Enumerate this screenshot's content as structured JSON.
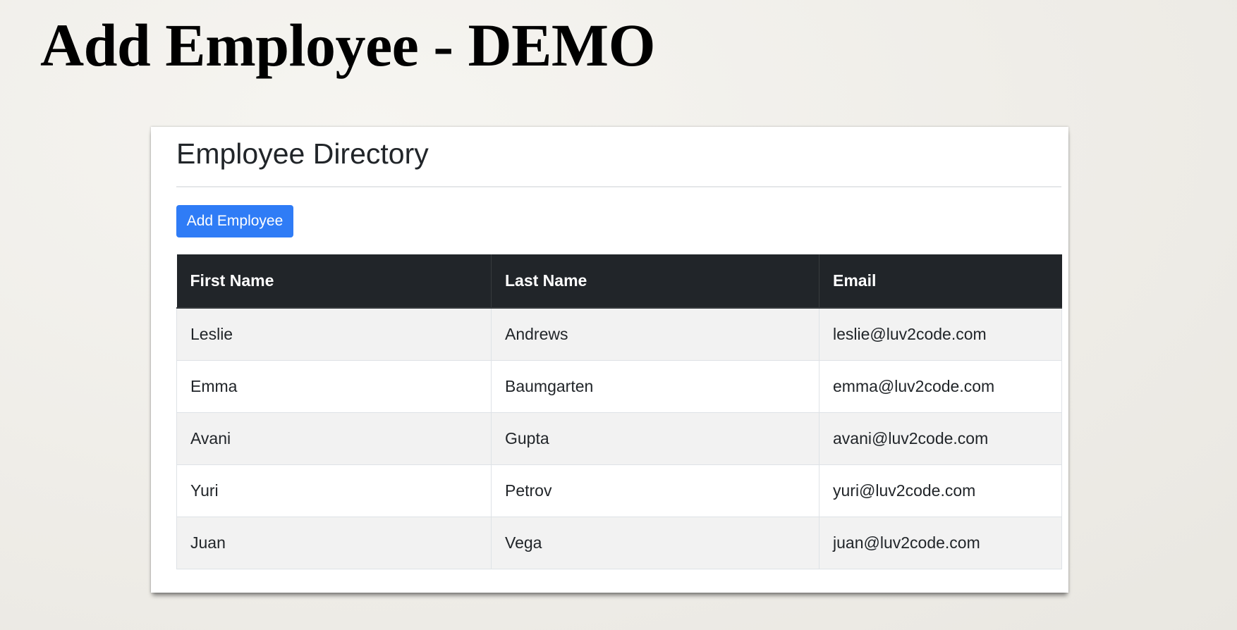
{
  "slide": {
    "title": "Add Employee - DEMO"
  },
  "app": {
    "heading": "Employee Directory",
    "add_button_label": "Add Employee",
    "colors": {
      "primary_button": "#2f7cf6",
      "table_header": "#212529",
      "striped_row": "#f2f2f2"
    }
  },
  "table": {
    "headers": [
      "First Name",
      "Last Name",
      "Email"
    ],
    "rows": [
      [
        "Leslie",
        "Andrews",
        "leslie@luv2code.com"
      ],
      [
        "Emma",
        "Baumgarten",
        "emma@luv2code.com"
      ],
      [
        "Avani",
        "Gupta",
        "avani@luv2code.com"
      ],
      [
        "Yuri",
        "Petrov",
        "yuri@luv2code.com"
      ],
      [
        "Juan",
        "Vega",
        "juan@luv2code.com"
      ]
    ]
  }
}
